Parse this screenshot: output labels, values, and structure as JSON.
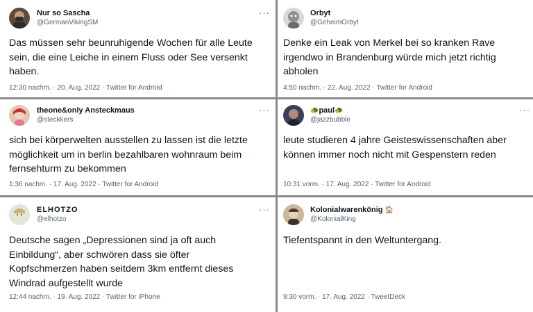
{
  "tweets": [
    {
      "display_name": "Nur so Sascha",
      "handle": "@GermanVikingSM",
      "text": "Das müssen sehr beunruhigende Wochen für alle Leute\nsein, die eine Leiche in einem Fluss oder See versenkt\nhaben.",
      "time": "12:30 nachm. · 20. Aug. 2022 · Twitter for Android",
      "more": "···"
    },
    {
      "display_name": "Orbyt",
      "handle": "@GeheimOrbyt",
      "text": "Denke ein Leak von Merkel bei so kranken Rave\nirgendwo in Brandenburg würde mich jetzt richtig\nabholen",
      "time": "4:50 nachm. · 22. Aug. 2022 · Twitter for Android",
      "more": ""
    },
    {
      "display_name": "theone&only Ansteckmaus",
      "handle": "@steckkers",
      "text": "sich bei körperwelten ausstellen zu lassen ist die letzte\nmöglichkeit um in berlin bezahlbaren wohnraum beim\nfernsehturm zu bekommen",
      "time": "1:36 nachm. · 17. Aug. 2022 · Twitter for Android",
      "more": "···"
    },
    {
      "display_name": "paul",
      "name_prefix": "🐢",
      "name_suffix": "🐢",
      "handle": "@jazzbubble",
      "text": "leute studieren 4 jahre Geisteswissenschaften aber\nkönnen immer noch nicht mit Gespenstern reden",
      "time": "10:31 vorm. · 17. Aug. 2022 · Twitter for Android",
      "more": "···"
    },
    {
      "display_name": "ELHOTZO",
      "handle": "@elhotzo",
      "text": "Deutsche sagen „Depressionen sind ja oft auch\nEinbildung“, aber schwören dass sie öfter\nKopfschmerzen haben seitdem 3km entfernt dieses\nWindrad aufgestellt wurde",
      "time": "12:44 nachm. · 19. Aug. 2022 · Twitter for iPhone",
      "more": "···"
    },
    {
      "display_name": "Kolonialwarenkönig",
      "name_suffix": "🏠",
      "handle": "@KolonialKing",
      "text": "Tiefentspannt in den Weltuntergang.",
      "time": "9:30 vorm. · 17. Aug. 2022 · TweetDeck",
      "more": ""
    }
  ]
}
